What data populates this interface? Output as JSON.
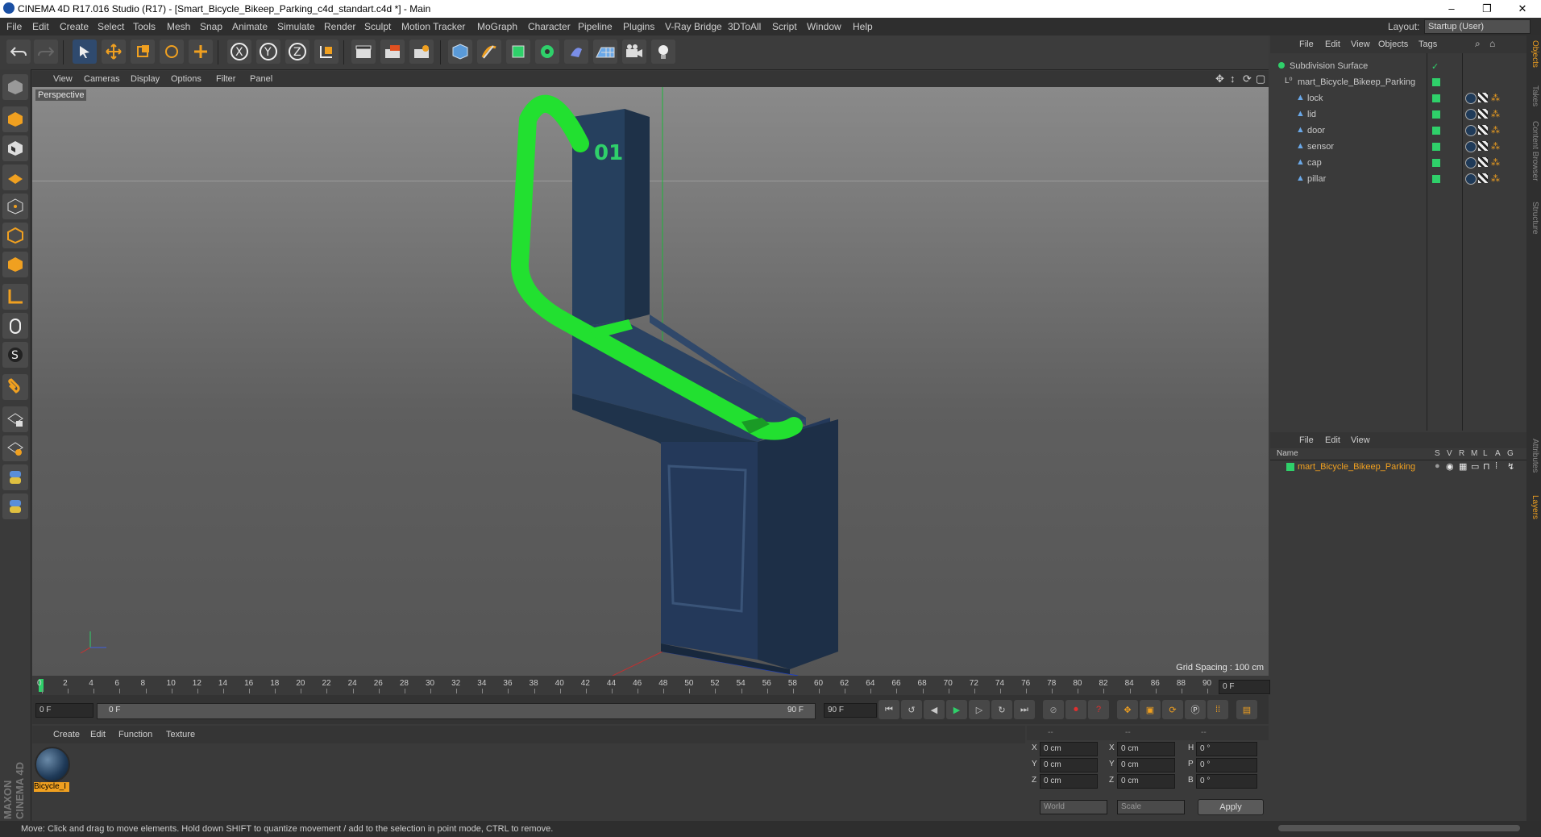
{
  "title_bar": {
    "title": "CINEMA 4D R17.016 Studio (R17) - [Smart_Bicycle_Bikeep_Parking_c4d_standart.c4d *] - Main",
    "minimize": "–",
    "maximize": "❐",
    "close": "✕"
  },
  "menu": {
    "items": [
      "File",
      "Edit",
      "Create",
      "Select",
      "Tools",
      "Mesh",
      "Snap",
      "Animate",
      "Simulate",
      "Render",
      "Sculpt",
      "Motion Tracker",
      "MoGraph",
      "Character",
      "Pipeline",
      "Plugins",
      "V-Ray Bridge",
      "3DToAll",
      "Script",
      "Window",
      "Help"
    ],
    "layout_label": "Layout:",
    "layout_value": "Startup (User)"
  },
  "viewport": {
    "menu": [
      "View",
      "Cameras",
      "Display",
      "Options",
      "Filter",
      "Panel"
    ],
    "camera_label": "Perspective",
    "grid_spacing": "Grid Spacing : 100 cm",
    "model_number": "01"
  },
  "timeline": {
    "ticks": [
      "0",
      "2",
      "4",
      "6",
      "8",
      "10",
      "12",
      "14",
      "16",
      "18",
      "20",
      "22",
      "24",
      "26",
      "28",
      "30",
      "32",
      "34",
      "36",
      "38",
      "40",
      "42",
      "44",
      "46",
      "48",
      "50",
      "52",
      "54",
      "56",
      "58",
      "60",
      "62",
      "64",
      "66",
      "68",
      "70",
      "72",
      "74",
      "76",
      "78",
      "80",
      "82",
      "84",
      "86",
      "88",
      "90"
    ],
    "current_frame": "0 F",
    "start_field": "0 F",
    "range_start": "0 F",
    "range_end": "90 F",
    "end_field": "90 F"
  },
  "material_manager": {
    "menu": [
      "Create",
      "Edit",
      "Function",
      "Texture"
    ],
    "material_label": "Bicycle_I"
  },
  "coordinates": {
    "headers": [
      "--",
      "--",
      "--"
    ],
    "rows": [
      {
        "a": "X",
        "av": "0 cm",
        "b": "X",
        "bv": "0 cm",
        "c": "H",
        "cv": "0 °"
      },
      {
        "a": "Y",
        "av": "0 cm",
        "b": "Y",
        "bv": "0 cm",
        "c": "P",
        "cv": "0 °"
      },
      {
        "a": "Z",
        "av": "0 cm",
        "b": "Z",
        "bv": "0 cm",
        "c": "B",
        "cv": "0 °"
      }
    ],
    "world": "World",
    "scale": "Scale",
    "apply": "Apply"
  },
  "object_manager": {
    "menu": [
      "File",
      "Edit",
      "View",
      "Objects",
      "Tags"
    ],
    "objects": [
      {
        "name": "Subdivision Surface",
        "level": 0
      },
      {
        "name": "mart_Bicycle_Bikeep_Parking",
        "level": 1
      },
      {
        "name": "lock",
        "level": 2
      },
      {
        "name": "lid",
        "level": 2
      },
      {
        "name": "door",
        "level": 2
      },
      {
        "name": "sensor",
        "level": 2
      },
      {
        "name": "cap",
        "level": 2
      },
      {
        "name": "pillar",
        "level": 2
      }
    ]
  },
  "layer_manager": {
    "menu": [
      "File",
      "Edit",
      "View"
    ],
    "col_name": "Name",
    "flags": [
      "S",
      "V",
      "R",
      "M",
      "L",
      "A",
      "G"
    ],
    "layer_name": "mart_Bicycle_Bikeep_Parking"
  },
  "side_tabs": [
    "Objects",
    "Takes",
    "Content Browser",
    "Structure",
    "Attributes",
    "Layers"
  ],
  "status_text": "Move: Click and drag to move elements. Hold down SHIFT to quantize movement / add to the selection in point mode, CTRL to remove.",
  "brand": "MAXON CINEMA 4D",
  "colors": {
    "accent": "#2fd06a",
    "selection": "#f0a020",
    "bracket": "#22e030",
    "model": "#23364f"
  }
}
